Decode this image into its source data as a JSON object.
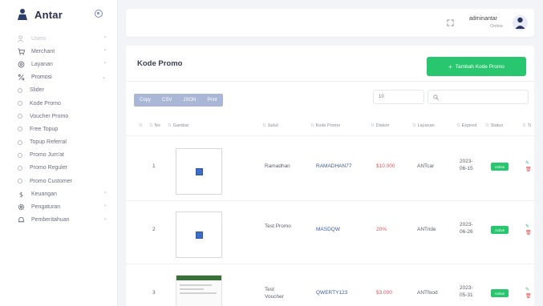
{
  "brand": {
    "name": "Antar"
  },
  "topbar": {
    "user_name": "adminantar",
    "user_status": "Online"
  },
  "sidebar": {
    "items": [
      {
        "label": "Users",
        "icon": "users-icon",
        "chevron": "›",
        "faded": true
      },
      {
        "label": "Merchant",
        "icon": "cart-icon",
        "chevron": "›"
      },
      {
        "label": "Layanan",
        "icon": "service-icon",
        "chevron": "›"
      },
      {
        "label": "Promosi",
        "icon": "percent-icon",
        "chevron": "⌄",
        "active": true
      },
      {
        "label": "Slider",
        "sub": true
      },
      {
        "label": "Kode Promo",
        "sub": true
      },
      {
        "label": "Voucher Promo",
        "sub": true
      },
      {
        "label": "Free Topup",
        "sub": true
      },
      {
        "label": "Topup Referral",
        "sub": true
      },
      {
        "label": "Promo Jum'at",
        "sub": true
      },
      {
        "label": "Promo Reguler",
        "sub": true
      },
      {
        "label": "Promo Customer",
        "sub": true
      },
      {
        "label": "Keuangan",
        "icon": "dollar-icon",
        "chevron": "›"
      },
      {
        "label": "Pengaturan",
        "icon": "gear-icon",
        "chevron": "›"
      },
      {
        "label": "Pemberitahuan",
        "icon": "bell-icon",
        "chevron": "›"
      }
    ]
  },
  "card": {
    "title": "Kode Promo",
    "add_button": "Tambah Kode Promo",
    "add_button_icon": "+",
    "export_buttons": [
      "Copy",
      "CSV",
      "JSON",
      "Print"
    ],
    "page_length": "10",
    "search_placeholder": ""
  },
  "table": {
    "columns": [
      "",
      "No",
      "Gambar",
      "Judul",
      "Kode Promo",
      "Diskon",
      "Layanan",
      "Expired",
      "Status",
      "Ti"
    ],
    "rows": [
      {
        "no": "1",
        "judul": "Ramadhan",
        "kode": "RAMADHAN77",
        "diskon": "$10.000",
        "layanan": "ANTcar",
        "expired": "2023-06-15",
        "status": "Active",
        "thumb": "placeholder"
      },
      {
        "no": "2",
        "judul": "Test Promo",
        "kode": "MASDQW",
        "diskon": "20%",
        "layanan": "ANTride",
        "expired": "2023-06-26",
        "status": "Active",
        "thumb": "placeholder"
      },
      {
        "no": "3",
        "judul": "Test Voucher",
        "kode": "QWERTY123",
        "diskon": "$3.000",
        "layanan": "ANTfood",
        "expired": "2023-05-31",
        "status": "Active",
        "thumb": "screenshot"
      }
    ]
  },
  "colors": {
    "accent_green": "#28c76f",
    "link_blue": "#3d5aa5",
    "price_red": "#e0565a",
    "export_bg": "#a9b6d6"
  }
}
